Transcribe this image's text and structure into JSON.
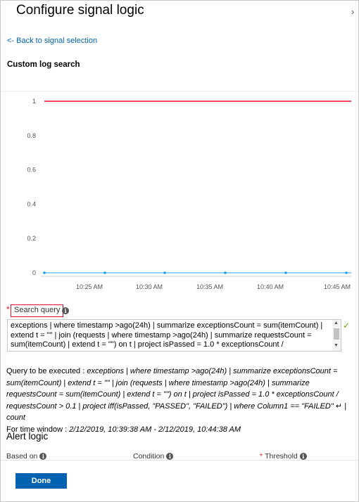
{
  "header": {
    "title": "Configure signal logic"
  },
  "back_link": "<- Back to signal selection",
  "section_title": "Custom log search",
  "chart_data": {
    "type": "line",
    "y_ticks": [
      "1",
      "0.8",
      "0.6",
      "0.4",
      "0.2",
      "0"
    ],
    "x_ticks": [
      "10:25 AM",
      "10:30 AM",
      "10:35 AM",
      "10:40 AM",
      "10:45 AM"
    ],
    "ylim": [
      0,
      1
    ],
    "grid": false,
    "series": [
      {
        "color": "#e81123",
        "values": [
          1,
          1,
          1,
          1,
          1,
          1
        ]
      },
      {
        "color": "#1ba1e2",
        "values": [
          0,
          0,
          0,
          0,
          0,
          0
        ]
      }
    ]
  },
  "search_query": {
    "label": "Search query",
    "value_lines": [
      "exceptions | where timestamp >ago(24h) | summarize exceptionsCount = sum(itemCount) |",
      "extend t = \"\" | join (requests | where timestamp >ago(24h) | summarize requestsCount =",
      "sum(itemCount) | extend t = \"\") on t | project isPassed = 1.0 * exceptionsCount /"
    ]
  },
  "query_exec": {
    "prefix": "Query to be executed : ",
    "query": "exceptions | where timestamp >ago(24h) | summarize exceptionsCount = sum(itemCount) | extend t = \"\" | join (requests | where timestamp >ago(24h) | summarize requestsCount = sum(itemCount) | extend t = \"\") on t | project isPassed = 1.0 * exceptionsCount / requestsCount > 0.1 | project iff(isPassed, \"PASSED\", \"FAILED\") | where Column1 == \"FAILED\" ↵ | count",
    "time_prefix": "For time window : ",
    "time_window": "2/12/2019, 10:39:38 AM - 2/12/2019, 10:44:38 AM"
  },
  "alert_logic": {
    "title": "Alert logic",
    "based_on": "Based on",
    "condition": "Condition",
    "threshold": "Threshold"
  },
  "footer": {
    "done_label": "Done"
  }
}
